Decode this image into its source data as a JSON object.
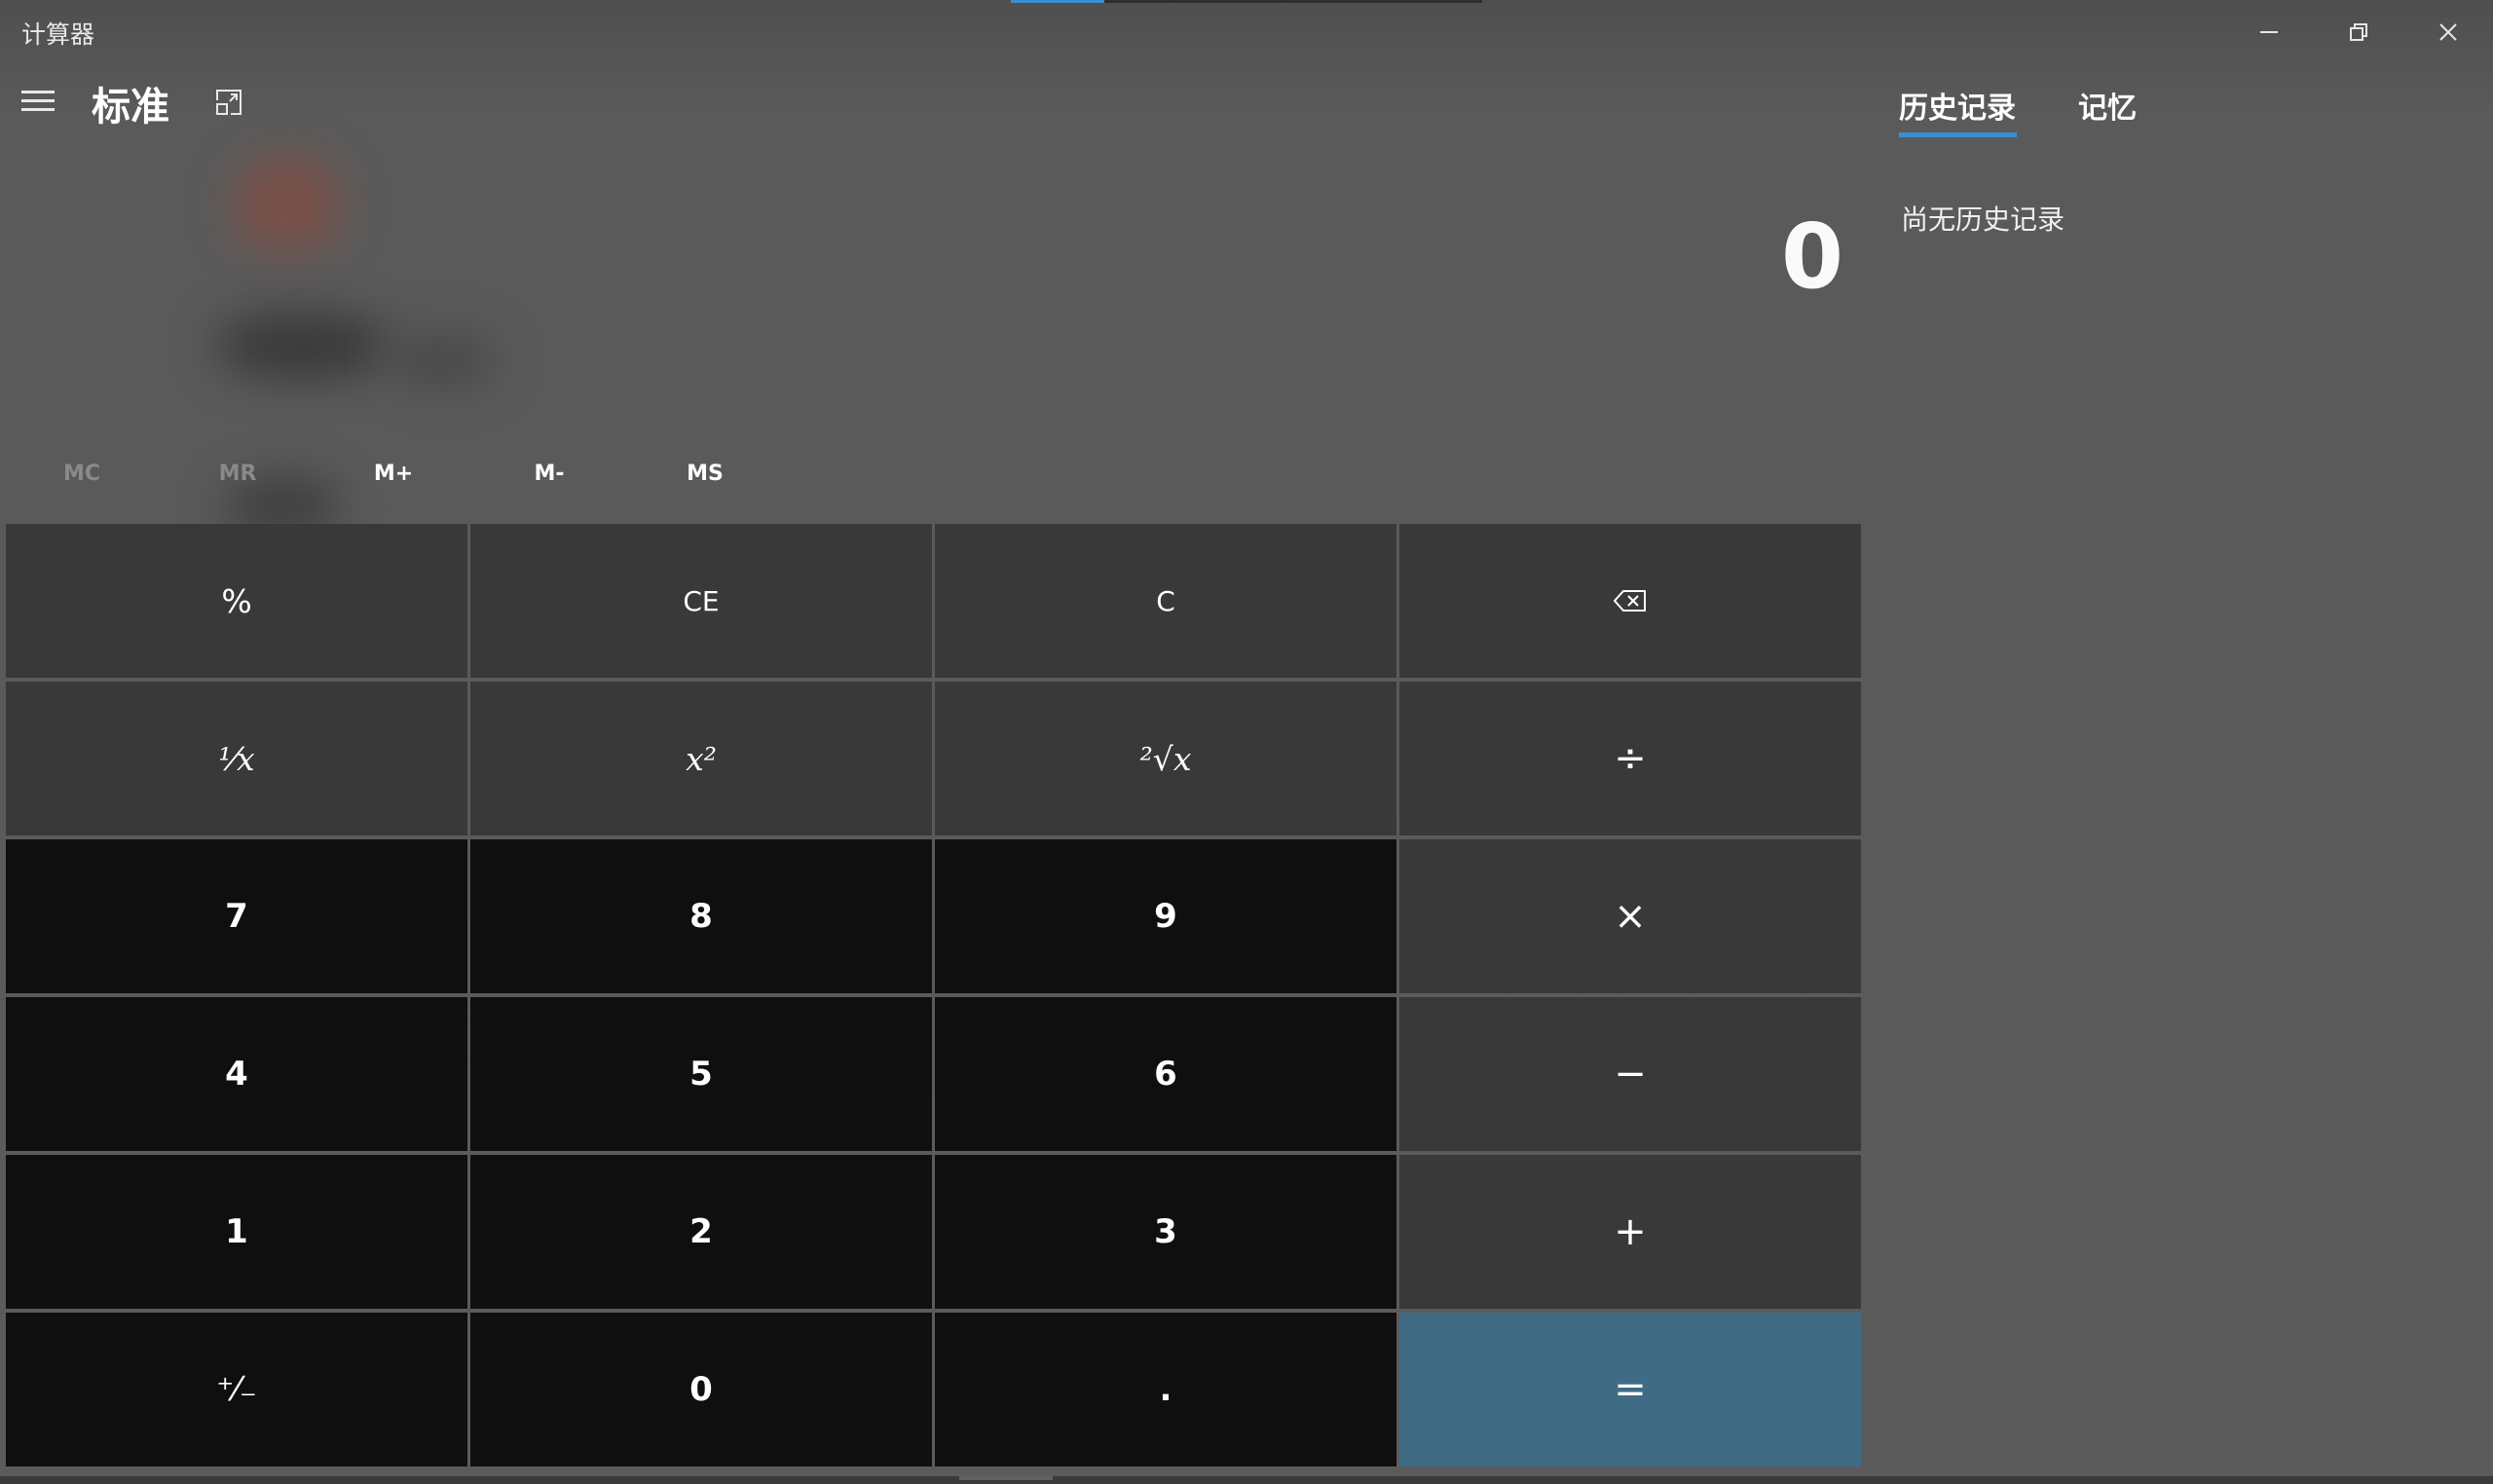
{
  "window": {
    "title": "计算器",
    "minimize_icon": "minimize-icon",
    "restore_icon": "restore-icon",
    "close_icon": "close-icon"
  },
  "header": {
    "menu_icon": "hamburger-menu-icon",
    "mode": "标准",
    "keep_on_top_icon": "keep-on-top-icon"
  },
  "display": {
    "value": "0"
  },
  "memory": [
    {
      "label": "MC",
      "enabled": false
    },
    {
      "label": "MR",
      "enabled": false
    },
    {
      "label": "M+",
      "enabled": true
    },
    {
      "label": "M-",
      "enabled": true
    },
    {
      "label": "MS",
      "enabled": true
    }
  ],
  "keys": {
    "percent": "%",
    "ce": "CE",
    "c": "C",
    "backspace_icon": "backspace-icon",
    "reciprocal": "¹⁄x",
    "square": "x²",
    "sqrt": "²√x",
    "divide": "÷",
    "multiply": "×",
    "minus": "−",
    "plus": "+",
    "equals": "=",
    "negate": "⁺⁄₋",
    "decimal": ".",
    "d0": "0",
    "d1": "1",
    "d2": "2",
    "d3": "3",
    "d4": "4",
    "d5": "5",
    "d6": "6",
    "d7": "7",
    "d8": "8",
    "d9": "9"
  },
  "panel": {
    "tabs": [
      {
        "label": "历史记录",
        "active": true
      },
      {
        "label": "记忆",
        "active": false
      }
    ],
    "empty_text": "尚无历史记录"
  },
  "colors": {
    "accent": "#3b8fd0",
    "equals_key": "#3f6b85",
    "number_key": "#0f0f0f",
    "operator_key": "#393939",
    "background": "#575757"
  }
}
